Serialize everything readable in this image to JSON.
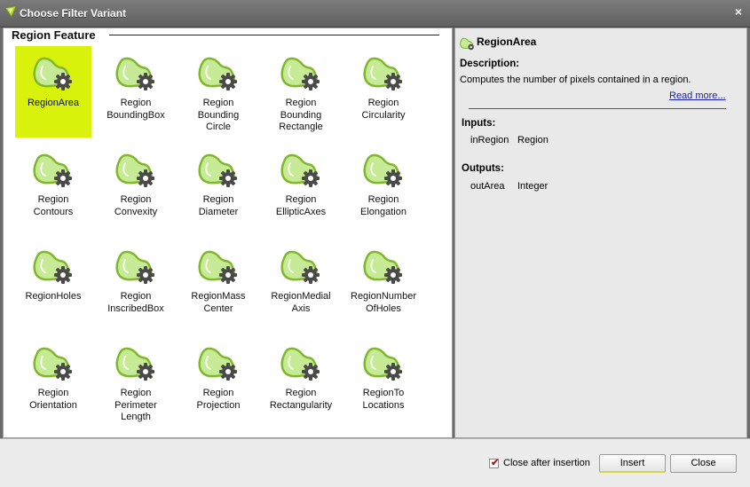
{
  "window": {
    "title": "Choose Filter Variant",
    "close_glyph": "×"
  },
  "group": {
    "title": "Region Feature"
  },
  "filters": [
    {
      "label": "RegionArea",
      "selected": true
    },
    {
      "label": "Region\nBoundingBox",
      "selected": false
    },
    {
      "label": "Region\nBounding\nCircle",
      "selected": false
    },
    {
      "label": "Region\nBounding\nRectangle",
      "selected": false
    },
    {
      "label": "Region\nCircularity",
      "selected": false
    },
    {
      "label": "Region\nContours",
      "selected": false
    },
    {
      "label": "Region\nConvexity",
      "selected": false
    },
    {
      "label": "Region\nDiameter",
      "selected": false
    },
    {
      "label": "Region\nEllipticAxes",
      "selected": false
    },
    {
      "label": "Region\nElongation",
      "selected": false
    },
    {
      "label": "RegionHoles",
      "selected": false
    },
    {
      "label": "Region\nInscribedBox",
      "selected": false
    },
    {
      "label": "RegionMass\nCenter",
      "selected": false
    },
    {
      "label": "RegionMedial\nAxis",
      "selected": false
    },
    {
      "label": "RegionNumber\nOfHoles",
      "selected": false
    },
    {
      "label": "Region\nOrientation",
      "selected": false
    },
    {
      "label": "Region\nPerimeter\nLength",
      "selected": false
    },
    {
      "label": "Region\nProjection",
      "selected": false
    },
    {
      "label": "Region\nRectangularity",
      "selected": false
    },
    {
      "label": "RegionTo\nLocations",
      "selected": false
    }
  ],
  "details": {
    "name": "RegionArea",
    "description_label": "Description:",
    "description": "Computes the number of pixels contained in a region.",
    "read_more": "Read more...",
    "inputs_label": "Inputs:",
    "inputs": [
      {
        "name": "inRegion",
        "type": "Region"
      }
    ],
    "outputs_label": "Outputs:",
    "outputs": [
      {
        "name": "outArea",
        "type": "Integer"
      }
    ]
  },
  "footer": {
    "close_after_insertion_label": "Close after insertion",
    "close_after_insertion_checked": true,
    "insert_label": "Insert",
    "close_label": "Close"
  },
  "colors": {
    "selection": "#d8f20b",
    "blob_fill": "#c6ea96",
    "blob_stroke": "#7fb82a",
    "gear": "#4a4a4a"
  }
}
